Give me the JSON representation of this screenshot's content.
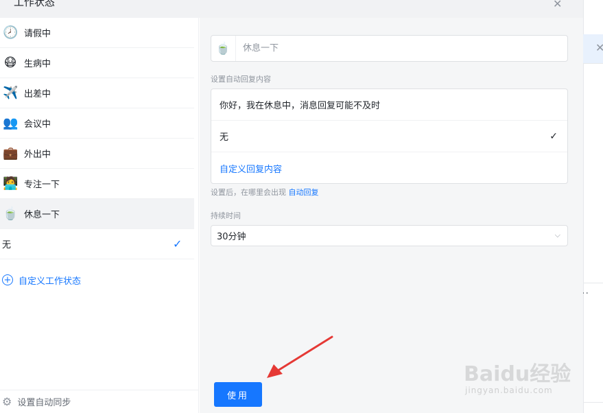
{
  "dialog": {
    "title": "工作状态",
    "close_icon": "close-icon"
  },
  "statuses": [
    {
      "emoji": "🕗",
      "icon": "clock-icon",
      "label": "请假中"
    },
    {
      "emoji": "😷",
      "icon": "mask-face-icon",
      "label": "生病中"
    },
    {
      "emoji": "✈️",
      "icon": "airplane-icon",
      "label": "出差中"
    },
    {
      "emoji": "👥",
      "icon": "meeting-icon",
      "label": "会议中"
    },
    {
      "emoji": "💼",
      "icon": "briefcase-icon",
      "label": "外出中"
    },
    {
      "emoji": "🧑‍💻",
      "icon": "focus-person-icon",
      "label": "专注一下"
    },
    {
      "emoji": "🍵",
      "icon": "tea-cup-icon",
      "label": "休息一下",
      "selected": true
    }
  ],
  "none_option": {
    "label": "无",
    "checked": true
  },
  "custom_status": {
    "label": "自定义工作状态"
  },
  "sync": {
    "label": "设置自动同步"
  },
  "form": {
    "status_input_emoji": "🍵",
    "status_input_placeholder": "休息一下",
    "auto_reply_label": "设置自动回复内容",
    "reply_options": [
      {
        "label": "你好，我在休息中，消息回复可能不及时"
      },
      {
        "label": "无",
        "checked": true
      },
      {
        "label": "自定义回复内容"
      }
    ],
    "hint_prefix": "设置后，在哪里会出现",
    "hint_link": "自动回复",
    "duration_label": "持续时间",
    "duration_value": "30分钟"
  },
  "use_button": {
    "label": "使用"
  },
  "watermark": {
    "text": "Baidu经验",
    "sub": "jingyan.baidu.com"
  },
  "colors": {
    "accent": "#1677ff",
    "arrow": "#e53935"
  }
}
